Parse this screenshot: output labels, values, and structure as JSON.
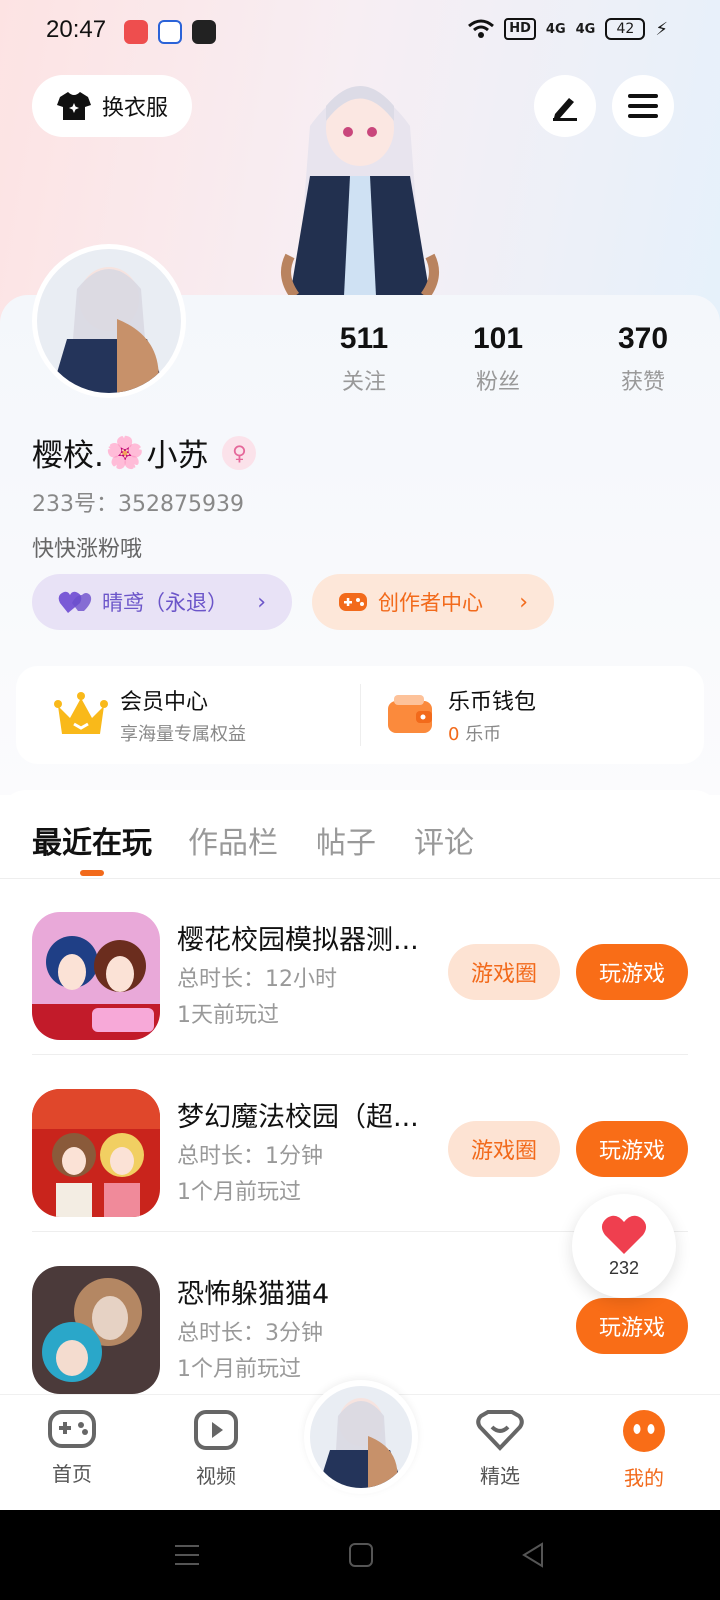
{
  "status_bar": {
    "time": "20:47",
    "hd": "HD",
    "net1": "4G",
    "net2": "4G",
    "battery": "42"
  },
  "header": {
    "dress_label": "换衣服"
  },
  "profile": {
    "nickname_part1": "樱校.",
    "nickname_part2": "小苏",
    "user_id": "233号：352875939",
    "bio": "快快涨粉哦",
    "stats": [
      {
        "num": "511",
        "label": "关注"
      },
      {
        "num": "101",
        "label": "粉丝"
      },
      {
        "num": "370",
        "label": "获赞"
      }
    ],
    "badge_label": "晴鸢（永退）",
    "creator_label": "创作者中心"
  },
  "wallet": {
    "vip_title": "会员中心",
    "vip_sub": "享海量专属权益",
    "coin_title": "乐币钱包",
    "coin_amount": "0",
    "coin_unit": "乐币"
  },
  "tabs": [
    "最近在玩",
    "作品栏",
    "帖子",
    "评论"
  ],
  "games": [
    {
      "name": "樱花校园模拟器测...",
      "duration": "总时长：12小时",
      "last": "1天前玩过",
      "circle": "游戏圈",
      "play": "玩游戏"
    },
    {
      "name": "梦幻魔法校园（超...",
      "duration": "总时长：1分钟",
      "last": "1个月前玩过",
      "circle": "游戏圈",
      "play": "玩游戏"
    },
    {
      "name": "恐怖躲猫猫4",
      "duration": "总时长：3分钟",
      "last": "1个月前玩过",
      "play": "玩游戏"
    }
  ],
  "like": {
    "count": "232"
  },
  "bottom_nav": [
    {
      "label": "首页"
    },
    {
      "label": "视频"
    },
    {
      "label": "精选"
    },
    {
      "label": "我的"
    }
  ],
  "colors": {
    "accent": "#f96d17",
    "purple": "#6b55c9"
  }
}
